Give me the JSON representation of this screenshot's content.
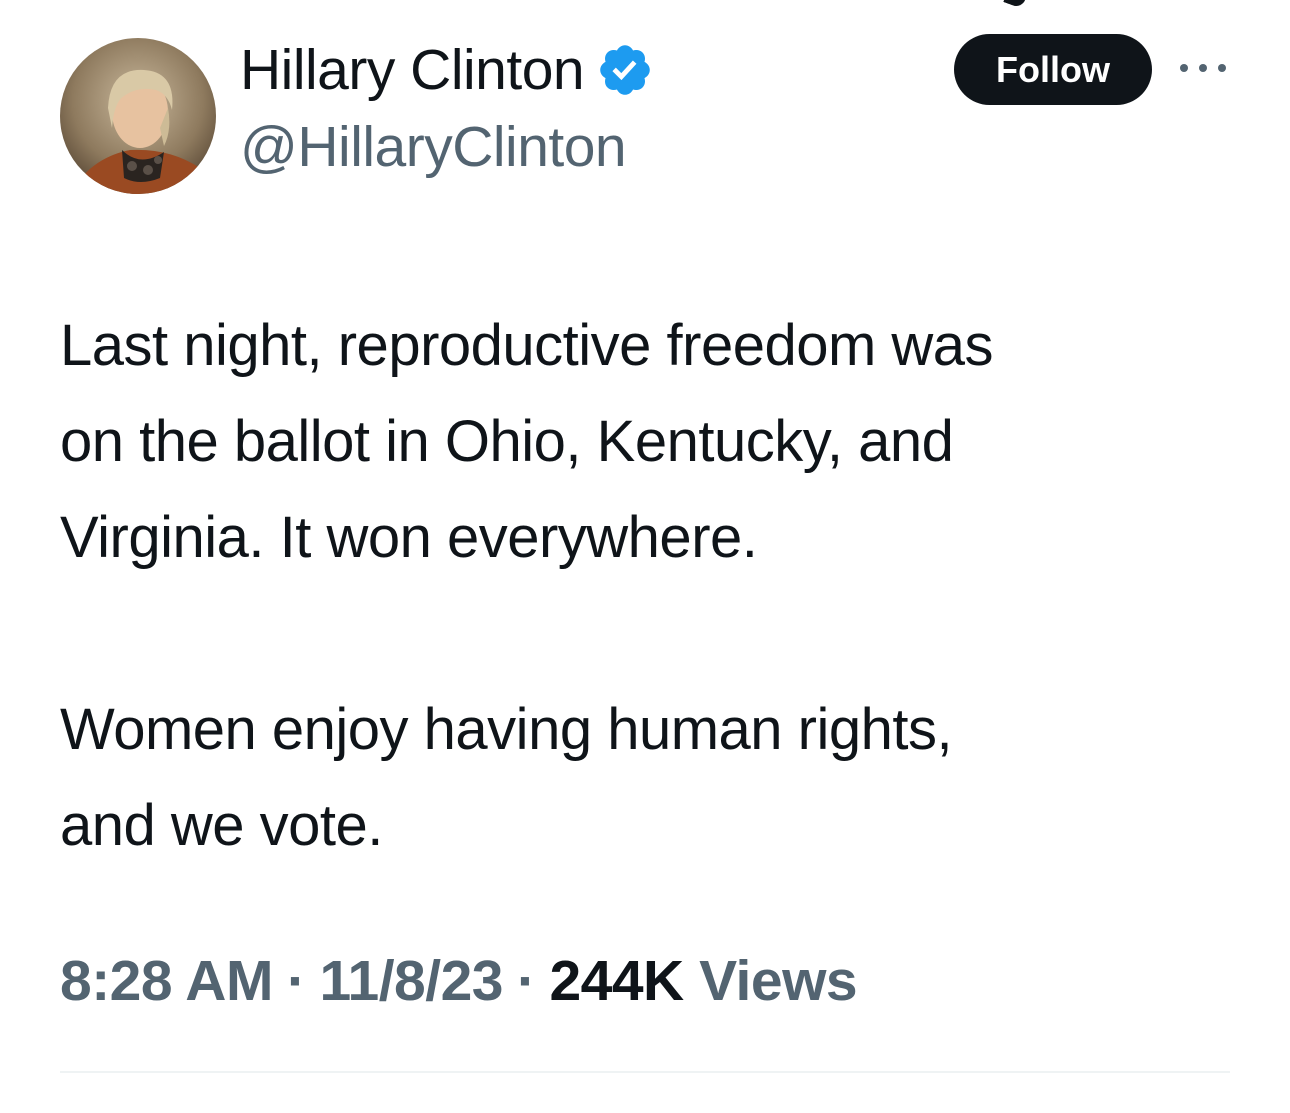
{
  "tweet": {
    "author": {
      "display_name": "Hillary Clinton",
      "handle": "@HillaryClinton",
      "verified": true
    },
    "follow_label": "Follow",
    "text_paragraph_1": "Last night, reproductive freedom was\non the ballot in Ohio, Kentucky, and\nVirginia. It won everywhere.",
    "text_paragraph_2": "Women enjoy having human rights,\nand we vote.",
    "time": "8:28 AM",
    "date": "11/8/23",
    "separator": "·",
    "views_count": "244K",
    "views_label": "Views"
  },
  "icons": {
    "verified": "verified-badge-icon",
    "more": "more-options-icon",
    "avatar": "profile-photo"
  },
  "colors": {
    "text_primary": "#0f1419",
    "text_secondary": "#536471",
    "verified_blue": "#1d9bf0",
    "follow_bg": "#0f1419",
    "divider": "#eff3f4"
  }
}
